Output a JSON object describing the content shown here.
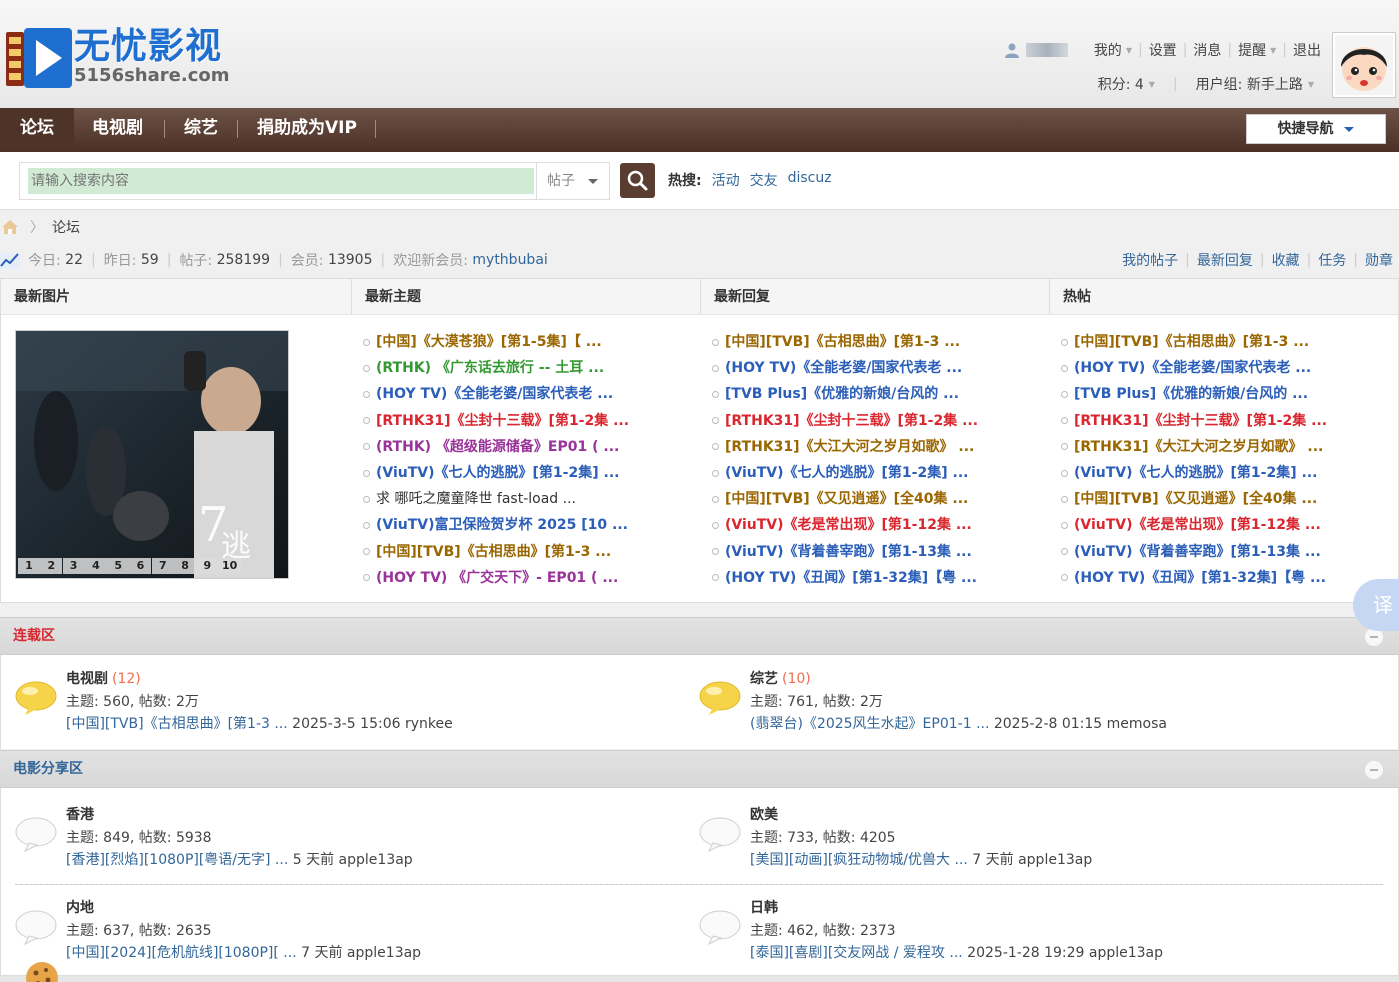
{
  "logo": {
    "title": "无忧影视",
    "subtitle": "5156share.com"
  },
  "user": {
    "my": "我的",
    "settings": "设置",
    "messages": "消息",
    "reminders": "提醒",
    "logout": "退出",
    "points": "积分: 4",
    "usergroup": "用户组: 新手上路"
  },
  "nav": {
    "items": [
      "论坛",
      "电视剧",
      "综艺",
      "捐助成为VIP"
    ],
    "quick_nav": "快捷导航"
  },
  "search": {
    "placeholder": "请输入搜索内容",
    "type": "帖子",
    "hot_label": "热搜:",
    "hot_terms": [
      "活动",
      "交友",
      "discuz"
    ]
  },
  "breadcrumb": {
    "current": "论坛"
  },
  "stats": {
    "today_label": "今日:",
    "today": "22",
    "yesterday_label": "昨日:",
    "yesterday": "59",
    "posts_label": "帖子:",
    "posts": "258199",
    "members_label": "会员:",
    "members": "13905",
    "welcome_label": "欢迎新会员:",
    "new_member": "mythbubai",
    "links": [
      "我的帖子",
      "最新回复",
      "收藏",
      "任务",
      "勋章"
    ]
  },
  "grid": {
    "headers": [
      "最新图片",
      "最新主题",
      "最新回复",
      "热帖"
    ],
    "slide_numbers": [
      "1",
      "2",
      "3",
      "4",
      "5",
      "6",
      "7",
      "8",
      "9",
      "10"
    ],
    "latest_topics": [
      {
        "text": "[中国]《大漠苍狼》[第1-5集]【 ...",
        "color": "brown"
      },
      {
        "text": "(RTHK) 《广东话去旅行 -- 土耳 ...",
        "color": "green"
      },
      {
        "text": "(HOY TV)《全能老婆/国家代表老 ...",
        "color": "blue"
      },
      {
        "text": "[RTHK31]《尘封十三载》[第1-2集 ...",
        "color": "red"
      },
      {
        "text": "(RTHK) 《超级能源储备》EP01 ( ...",
        "color": "purple"
      },
      {
        "text": "(ViuTV)《七人的逃脱》[第1-2集] ...",
        "color": "blue"
      },
      {
        "text": "求 哪吒之魔童降世 fast-load ...",
        "color": "dark"
      },
      {
        "text": "(ViuTV)富卫保险贺岁杯 2025 [10 ...",
        "color": "blue"
      },
      {
        "text": "[中国][TVB]《古相思曲》[第1-3 ...",
        "color": "brown"
      },
      {
        "text": "(HOY TV) 《广交天下》- EP01 ( ...",
        "color": "purple"
      }
    ],
    "latest_replies": [
      {
        "text": "[中国][TVB]《古相思曲》[第1-3 ...",
        "color": "brown"
      },
      {
        "text": "(HOY TV)《全能老婆/国家代表老 ...",
        "color": "blue"
      },
      {
        "text": "[TVB Plus]《优雅的新娘/台风的 ...",
        "color": "blue"
      },
      {
        "text": "[RTHK31]《尘封十三载》[第1-2集 ...",
        "color": "red"
      },
      {
        "text": "[RTHK31]《大江大河之岁月如歌》 ...",
        "color": "brown"
      },
      {
        "text": "(ViuTV)《七人的逃脱》[第1-2集] ...",
        "color": "blue"
      },
      {
        "text": "[中国][TVB]《又见逍遥》[全40集 ...",
        "color": "brown"
      },
      {
        "text": "(ViuTV)《老是常出现》[第1-12集 ...",
        "color": "red"
      },
      {
        "text": "(ViuTV)《背着善宰跑》[第1-13集 ...",
        "color": "blue"
      },
      {
        "text": "(HOY TV)《丑闻》[第1-32集]【粤 ...",
        "color": "blue"
      }
    ],
    "hot_posts": [
      {
        "text": "[中国][TVB]《古相思曲》[第1-3 ...",
        "color": "brown"
      },
      {
        "text": "(HOY TV)《全能老婆/国家代表老 ...",
        "color": "blue"
      },
      {
        "text": "[TVB Plus]《优雅的新娘/台风的 ...",
        "color": "blue"
      },
      {
        "text": "[RTHK31]《尘封十三载》[第1-2集 ...",
        "color": "red"
      },
      {
        "text": "[RTHK31]《大江大河之岁月如歌》 ...",
        "color": "brown"
      },
      {
        "text": "(ViuTV)《七人的逃脱》[第1-2集] ...",
        "color": "blue"
      },
      {
        "text": "[中国][TVB]《又见逍遥》[全40集 ...",
        "color": "brown"
      },
      {
        "text": "(ViuTV)《老是常出现》[第1-12集 ...",
        "color": "red"
      },
      {
        "text": "(ViuTV)《背着善宰跑》[第1-13集 ...",
        "color": "blue"
      },
      {
        "text": "(HOY TV)《丑闻》[第1-32集]【粤 ...",
        "color": "blue"
      }
    ]
  },
  "sections": {
    "serial": {
      "title": "连载区",
      "forums": [
        {
          "name": "电视剧",
          "today": "(12)",
          "stats": "主题: 560, 帖数: 2万",
          "last_link": "[中国][TVB]《古相思曲》[第1-3 ...",
          "last_meta": " 2025-3-5 15:06 rynkee"
        },
        {
          "name": "综艺",
          "today": "(10)",
          "stats": "主题: 761, 帖数: 2万",
          "last_link": "(翡翠台)《2025风生水起》EP01-1 ...",
          "last_meta": " 2025-2-8 01:15 memosa"
        }
      ]
    },
    "movies": {
      "title": "电影分享区",
      "forums": [
        {
          "name": "香港",
          "stats": "主题: 849, 帖数: 5938",
          "last_link": "[香港][烈焰][1080P][粤语/无字] ...",
          "last_meta": " 5 天前 apple13ap"
        },
        {
          "name": "欧美",
          "stats": "主题: 733, 帖数: 4205",
          "last_link": "[美国][动画][疯狂动物城/优兽大 ...",
          "last_meta": " 7 天前 apple13ap"
        },
        {
          "name": "内地",
          "stats": "主题: 637, 帖数: 2635",
          "last_link": "[中国][2024][危机航线][1080P][ ...",
          "last_meta": " 7 天前 apple13ap"
        },
        {
          "name": "日韩",
          "stats": "主题: 462, 帖数: 2373",
          "last_link": "[泰国][喜剧][交友网战 / 爱程攻 ...",
          "last_meta": " 2025-1-28 19:29 apple13ap"
        }
      ]
    }
  },
  "translate_button": "译",
  "colors": {
    "nav_bg": "#5a3d31",
    "link_blue": "#336699",
    "serial_title": "#d9262f",
    "movie_title": "#336699"
  }
}
